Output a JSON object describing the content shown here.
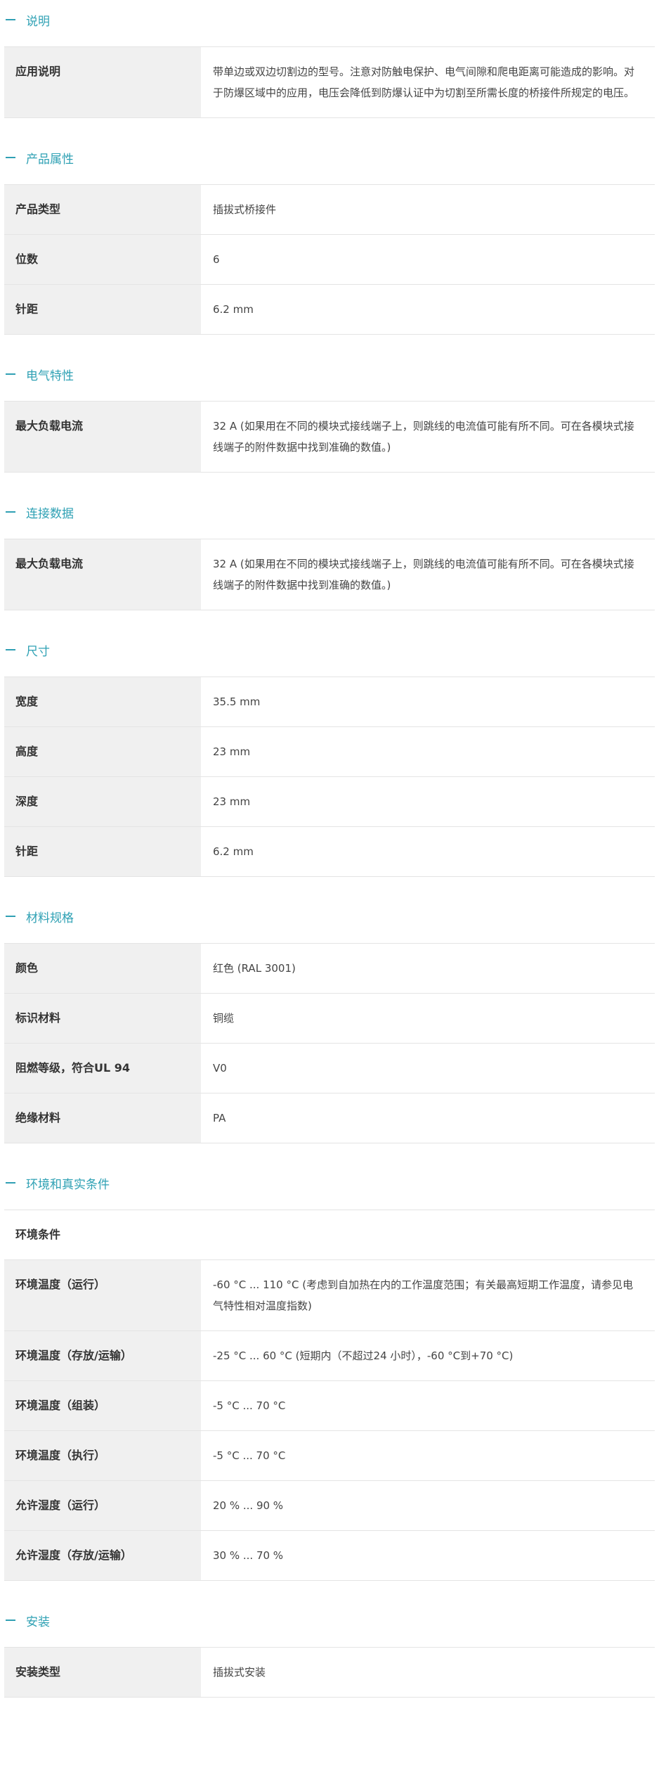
{
  "sections": [
    {
      "title": "说明",
      "rows": [
        {
          "k": "应用说明",
          "v": "带单边或双边切割边的型号。注意对防触电保护、电气间隙和爬电距离可能造成的影响。对于防爆区域中的应用，电压会降低到防爆认证中为切割至所需长度的桥接件所规定的电压。"
        }
      ]
    },
    {
      "title": "产品属性",
      "rows": [
        {
          "k": "产品类型",
          "v": "插拔式桥接件"
        },
        {
          "k": "位数",
          "v": "6"
        },
        {
          "k": "针距",
          "v": "6.2 mm"
        }
      ]
    },
    {
      "title": "电气特性",
      "rows": [
        {
          "k": "最大负载电流",
          "v": "32 A (如果用在不同的模块式接线端子上，则跳线的电流值可能有所不同。可在各模块式接线端子的附件数据中找到准确的数值。)"
        }
      ]
    },
    {
      "title": "连接数据",
      "rows": [
        {
          "k": "最大负载电流",
          "v": "32 A (如果用在不同的模块式接线端子上，则跳线的电流值可能有所不同。可在各模块式接线端子的附件数据中找到准确的数值。)"
        }
      ]
    },
    {
      "title": "尺寸",
      "rows": [
        {
          "k": "宽度",
          "v": "35.5 mm"
        },
        {
          "k": "高度",
          "v": "23 mm"
        },
        {
          "k": "深度",
          "v": "23 mm"
        },
        {
          "k": "针距",
          "v": "6.2 mm"
        }
      ]
    },
    {
      "title": "材料规格",
      "rows": [
        {
          "k": "颜色",
          "v": "红色 (RAL 3001)"
        },
        {
          "k": "标识材料",
          "v": "铜缆"
        },
        {
          "k": "阻燃等级，符合UL 94",
          "v": "V0"
        },
        {
          "k": "绝缘材料",
          "v": "PA"
        }
      ]
    },
    {
      "title": "环境和真实条件",
      "subhead": "环境条件",
      "rows": [
        {
          "k": "环境温度（运行）",
          "v": "-60 °C ... 110 °C (考虑到自加热在内的工作温度范围；有关最高短期工作温度，请参见电气特性相对温度指数)"
        },
        {
          "k": "环境温度（存放/运输）",
          "v": "-25 °C ... 60 °C (短期内（不超过24 小时），-60 °C到+70 °C)"
        },
        {
          "k": "环境温度（组装）",
          "v": "-5 °C ... 70 °C"
        },
        {
          "k": "环境温度（执行）",
          "v": "-5 °C ... 70 °C"
        },
        {
          "k": "允许湿度（运行）",
          "v": "20 % ... 90 %"
        },
        {
          "k": "允许湿度（存放/运输）",
          "v": "30 % ... 70 %"
        }
      ]
    },
    {
      "title": "安装",
      "rows": [
        {
          "k": "安装类型",
          "v": "插拔式安装"
        }
      ]
    }
  ],
  "colors": {
    "accent": "#2fa1b4",
    "key_bg": "#f0f0f0",
    "border": "#e4e4e4"
  }
}
